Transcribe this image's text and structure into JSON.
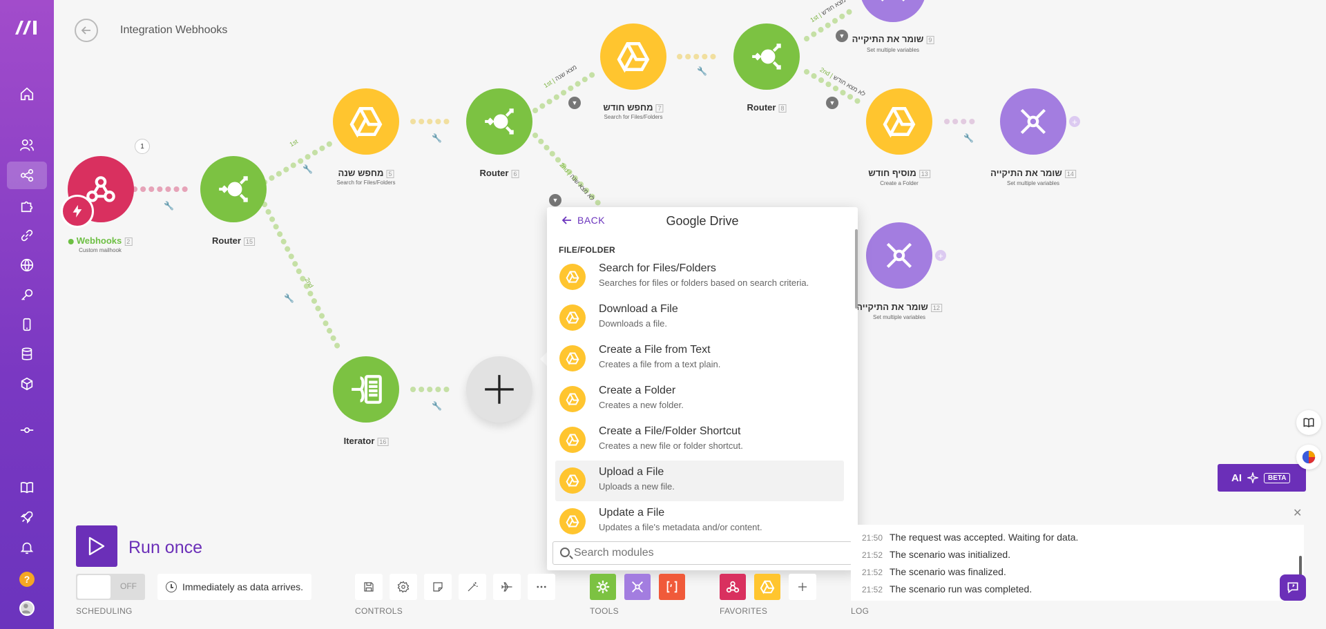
{
  "app": {
    "title": "Integration Webhooks"
  },
  "sidebar": {
    "items": [
      {
        "icon": "home-icon"
      },
      {
        "icon": "team-icon"
      },
      {
        "icon": "share-icon",
        "active": true
      },
      {
        "icon": "puzzle-icon"
      },
      {
        "icon": "link-icon"
      },
      {
        "icon": "globe-icon"
      },
      {
        "icon": "key-icon"
      },
      {
        "icon": "mobile-icon"
      },
      {
        "icon": "database-icon"
      },
      {
        "icon": "cube-icon"
      },
      {
        "icon": "commit-icon"
      },
      {
        "icon": "book-icon"
      },
      {
        "icon": "rocket-icon"
      },
      {
        "icon": "bell-icon"
      }
    ],
    "help": "?"
  },
  "nodes": {
    "webhooks": {
      "label": "Webhooks",
      "idx": "2",
      "sub": "Custom mailhook",
      "bubble": "1",
      "color": "#d9305f"
    },
    "router15": {
      "label": "Router",
      "idx": "15"
    },
    "search_year": {
      "label": "מחפש שנה",
      "idx": "5",
      "sub": "Search for Files/Folders"
    },
    "router6": {
      "label": "Router",
      "idx": "6"
    },
    "search_month": {
      "label": "מחפש חודש",
      "idx": "7",
      "sub": "Search for Files/Folders"
    },
    "router8": {
      "label": "Router",
      "idx": "8"
    },
    "save9": {
      "label": "שומר את התיקייה",
      "idx": "9",
      "sub": "Set multiple variables"
    },
    "add_month": {
      "label": "מוסיף חודש",
      "idx": "13",
      "sub": "Create a Folder"
    },
    "save14": {
      "label": "שומר את התיקייה",
      "idx": "14",
      "sub": "Set multiple variables"
    },
    "save12": {
      "label": "שומר את התיקייה",
      "idx": "12",
      "sub": "Set multiple variables"
    },
    "iterator": {
      "label": "Iterator",
      "idx": "16"
    }
  },
  "routes": {
    "r15_1st": {
      "order": "1st",
      "cond": ""
    },
    "r15_2nd": {
      "order": "2nd",
      "cond": ""
    },
    "r6_1st": {
      "order": "1st",
      "cond": "מצא שנה"
    },
    "r6_2nd": {
      "order": "2nd",
      "cond": "לא מצא שנה"
    },
    "r8_1st": {
      "order": "1st",
      "cond": "מצא חודש"
    },
    "r8_2nd": {
      "order": "2nd",
      "cond": "לא מצא חודש"
    }
  },
  "picker": {
    "back": "BACK",
    "app_name": "Google Drive",
    "section": "FILE/FOLDER",
    "modules": [
      {
        "title": "Search for Files/Folders",
        "desc": "Searches for files or folders based on search criteria."
      },
      {
        "title": "Download a File",
        "desc": "Downloads a file."
      },
      {
        "title": "Create a File from Text",
        "desc": "Creates a file from a text plain."
      },
      {
        "title": "Create a Folder",
        "desc": "Creates a new folder."
      },
      {
        "title": "Create a File/Folder Shortcut",
        "desc": "Creates a new file or folder shortcut."
      },
      {
        "title": "Upload a File",
        "desc": "Uploads a new file.",
        "hover": true
      },
      {
        "title": "Update a File",
        "desc": "Updates a file's metadata and/or content."
      }
    ],
    "search_placeholder": "Search modules"
  },
  "bottom": {
    "run_label": "Run once",
    "toggle_state": "OFF",
    "schedule": "Immediately as data arrives.",
    "sections": {
      "scheduling": "SCHEDULING",
      "controls": "CONTROLS",
      "tools": "TOOLS",
      "favorites": "FAVORITES",
      "log": "LOG"
    },
    "controls": [
      "save-icon",
      "settings-icon",
      "notes-icon",
      "magic-wand-icon",
      "airplane-icon",
      "more-icon"
    ],
    "tools": [
      {
        "icon": "gear-icon",
        "color": "#7cc242"
      },
      {
        "icon": "tools-icon",
        "color": "#a37de0"
      },
      {
        "icon": "json-brackets-icon",
        "color": "#f05a3a"
      }
    ],
    "favorites": [
      {
        "icon": "webhook-icon",
        "color": "#d9305f"
      },
      {
        "icon": "google-drive-icon",
        "color": "#ffc52f"
      }
    ]
  },
  "log": {
    "entries": [
      {
        "time": "21:50",
        "text": "The request was accepted. Waiting for data."
      },
      {
        "time": "21:52",
        "text": "The scenario was initialized."
      },
      {
        "time": "21:52",
        "text": "The scenario was finalized."
      },
      {
        "time": "21:52",
        "text": "The scenario run was completed."
      }
    ]
  },
  "ai": {
    "label": "AI",
    "badge": "BETA"
  },
  "colors": {
    "brand": "#6b2fb8",
    "router": "#7cc242",
    "drive": "#ffc52f",
    "tools": "#a37de0",
    "webhook": "#d9305f"
  }
}
